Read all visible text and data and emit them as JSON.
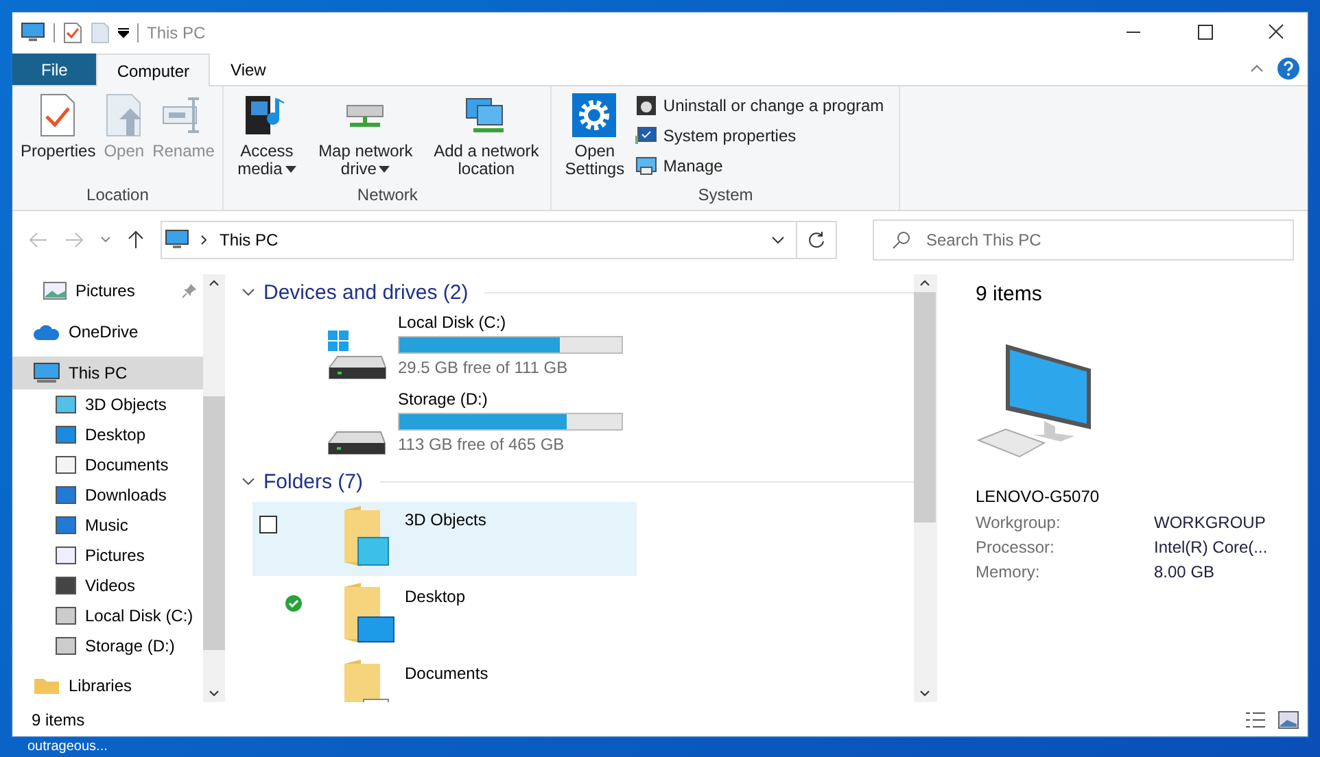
{
  "window": {
    "title": "This PC"
  },
  "ribbon": {
    "tabs": [
      {
        "label": "File",
        "kind": "file",
        "selected": false
      },
      {
        "label": "Computer",
        "kind": "tab",
        "selected": true
      },
      {
        "label": "View",
        "kind": "tab",
        "selected": false
      }
    ],
    "groups": [
      {
        "label": "Location",
        "items": [
          {
            "label": "Properties",
            "disabled": false,
            "dropdown": false
          },
          {
            "label": "Open",
            "disabled": true,
            "dropdown": false
          },
          {
            "label": "Rename",
            "disabled": true,
            "dropdown": false
          }
        ]
      },
      {
        "label": "Network",
        "items": [
          {
            "label": "Access media",
            "disabled": false,
            "dropdown": true
          },
          {
            "label": "Map network drive",
            "disabled": false,
            "dropdown": true
          },
          {
            "label": "Add a network location",
            "disabled": false,
            "dropdown": false
          }
        ]
      },
      {
        "label": "System",
        "items": [
          {
            "label": "Open Settings",
            "disabled": false,
            "dropdown": false
          }
        ],
        "small_items": [
          "Uninstall or change a program",
          "System properties",
          "Manage"
        ]
      }
    ]
  },
  "address": {
    "path": "This PC",
    "search_placeholder": "Search This PC"
  },
  "navigation": [
    {
      "label": "Pictures",
      "pinned": true,
      "selected": false
    },
    {
      "label": "OneDrive",
      "pinned": false,
      "selected": false
    },
    {
      "label": "This PC",
      "pinned": false,
      "selected": true,
      "children": [
        {
          "label": "3D Objects"
        },
        {
          "label": "Desktop"
        },
        {
          "label": "Documents"
        },
        {
          "label": "Downloads"
        },
        {
          "label": "Music"
        },
        {
          "label": "Pictures"
        },
        {
          "label": "Videos"
        },
        {
          "label": "Local Disk (C:)"
        },
        {
          "label": "Storage (D:)"
        }
      ]
    },
    {
      "label": "Libraries",
      "pinned": false,
      "selected": false
    }
  ],
  "sections": [
    {
      "title": "Devices and drives (2)",
      "kind": "drives",
      "items": [
        {
          "name": "Local Disk (C:)",
          "level": 0.72,
          "free": "29.5 GB free of 111 GB",
          "system": true
        },
        {
          "name": "Storage (D:)",
          "level": 0.755,
          "free": "113 GB free of 465 GB",
          "system": false
        }
      ]
    },
    {
      "title": "Folders (7)",
      "kind": "folders",
      "items": [
        {
          "name": "3D Objects",
          "hovered": true,
          "checked": false,
          "synced": false
        },
        {
          "name": "Desktop",
          "hovered": false,
          "checked": false,
          "synced": true
        },
        {
          "name": "Documents",
          "hovered": false,
          "checked": false,
          "synced": false
        }
      ]
    }
  ],
  "details": {
    "count": "9 items",
    "name": "LENOVO-G5070",
    "properties": [
      {
        "label": "Workgroup:",
        "value": "WORKGROUP"
      },
      {
        "label": "Processor:",
        "value": "Intel(R) Core(..."
      },
      {
        "label": "Memory:",
        "value": "8.00 GB"
      }
    ]
  },
  "status_bar": {
    "count": "9 items"
  },
  "desktop": {
    "label": "outrageous..."
  }
}
